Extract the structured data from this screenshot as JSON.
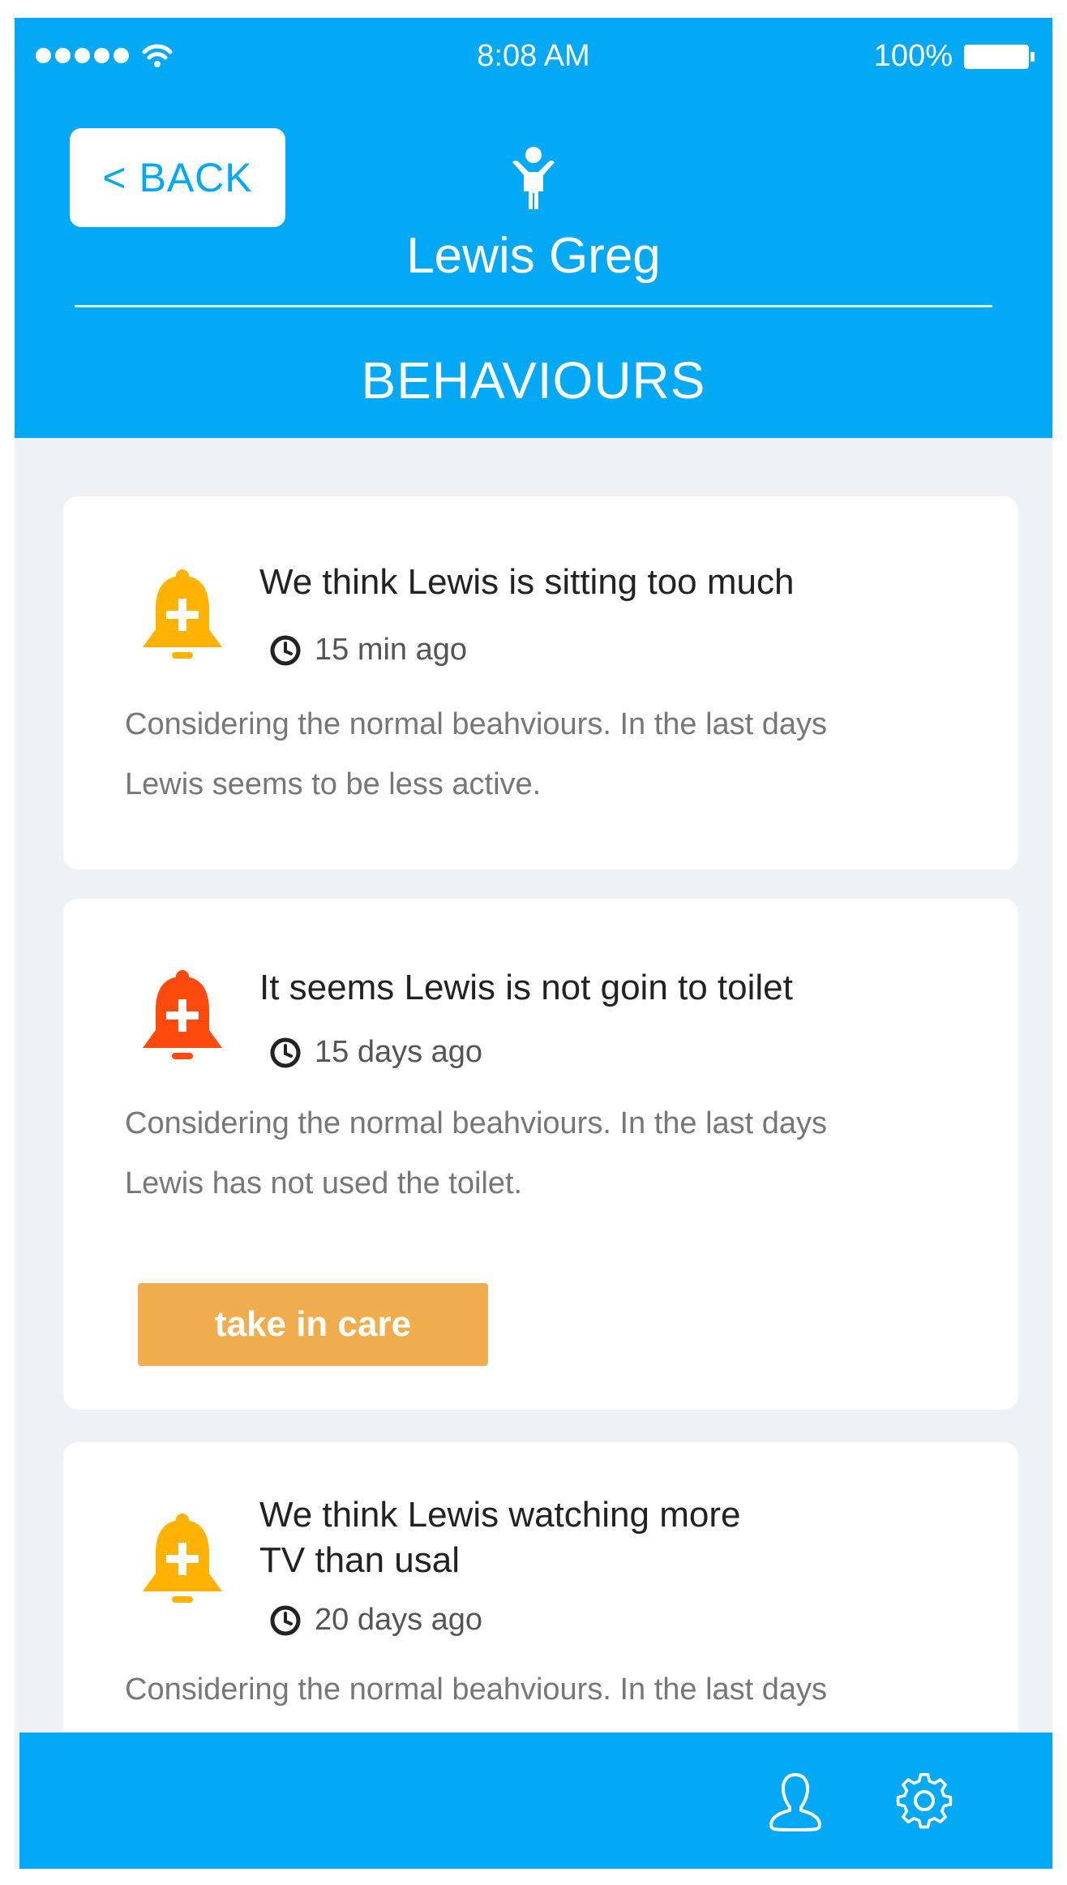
{
  "status_bar": {
    "time": "8:08 AM",
    "battery": "100%"
  },
  "header": {
    "back_label": "< BACK",
    "patient_name": "Lewis Greg",
    "section_title": "BEHAVIOURS",
    "icon": "person-icon"
  },
  "alerts": [
    {
      "title": "We think Lewis is sitting too much",
      "time": "15 min ago",
      "description_line1": "Considering the normal beahviours. In the last days",
      "description_line2": "Lewis seems to be less active.",
      "icon": "bell-plus-icon",
      "color": "#ffb300"
    },
    {
      "title": "It seems Lewis is not goin to toilet",
      "time": "15 days ago",
      "description_line1": "Considering the normal beahviours. In the last days",
      "description_line2": "Lewis has not used the toilet.",
      "action_label": "take in care",
      "icon": "bell-plus-icon",
      "color": "#ff4a0d"
    },
    {
      "title_line1": "We think Lewis watching more",
      "title_line2": "TV than usal",
      "time": "20 days ago",
      "description_line1": "Considering the normal beahviours. In the last days",
      "icon": "bell-plus-icon",
      "color": "#ffb300"
    }
  ],
  "bottom_bar": {
    "icons": [
      "profile-icon",
      "settings-icon"
    ]
  },
  "colors": {
    "primary": "#03a9f4",
    "background": "#eef2f7",
    "button": "#efad4d"
  }
}
